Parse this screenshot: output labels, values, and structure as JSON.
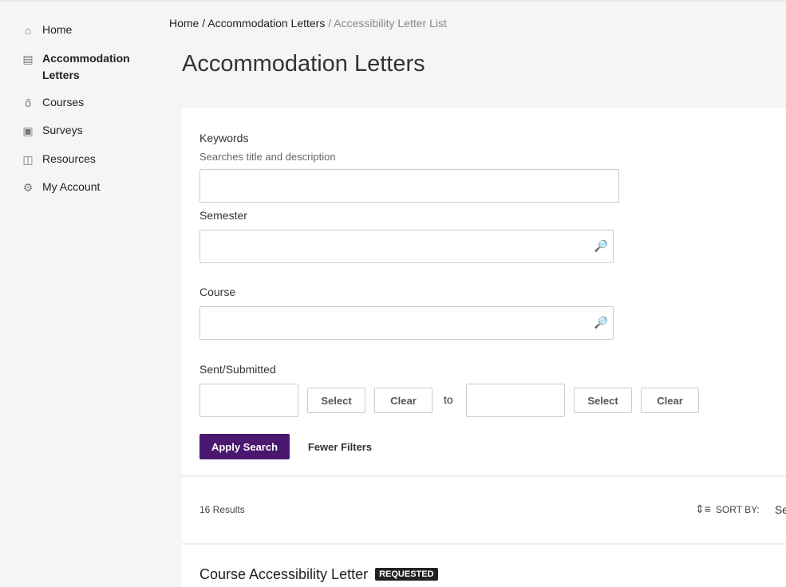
{
  "sidebar": {
    "items": [
      {
        "label": "Home",
        "icon": "home-icon"
      },
      {
        "label": "Accommodation Letters",
        "icon": "message-icon",
        "active": true
      },
      {
        "label": "Courses",
        "icon": "apple-icon"
      },
      {
        "label": "Surveys",
        "icon": "clipboard-icon"
      },
      {
        "label": "Resources",
        "icon": "folder-icon"
      },
      {
        "label": "My Account",
        "icon": "gear-icon"
      }
    ]
  },
  "breadcrumb": {
    "home": "Home",
    "sep": " / ",
    "parent": "Accommodation Letters",
    "current": "Accessibility Letter List"
  },
  "page_title": "Accommodation Letters",
  "filters": {
    "keywords_label": "Keywords",
    "keywords_hint": "Searches title and description",
    "keywords_value": "",
    "semester_label": "Semester",
    "semester_value": "",
    "course_label": "Course",
    "course_value": "",
    "sent_label": "Sent/Submitted",
    "select": "Select",
    "clear": "Clear",
    "to": "to",
    "apply": "Apply Search",
    "fewer": "Fewer Filters"
  },
  "results": {
    "count": "16 Results",
    "sort_label": "SORT BY:",
    "sort_value": "Se",
    "items": [
      {
        "title": "Course Accessibility Letter",
        "status": "REQUESTED"
      }
    ]
  }
}
